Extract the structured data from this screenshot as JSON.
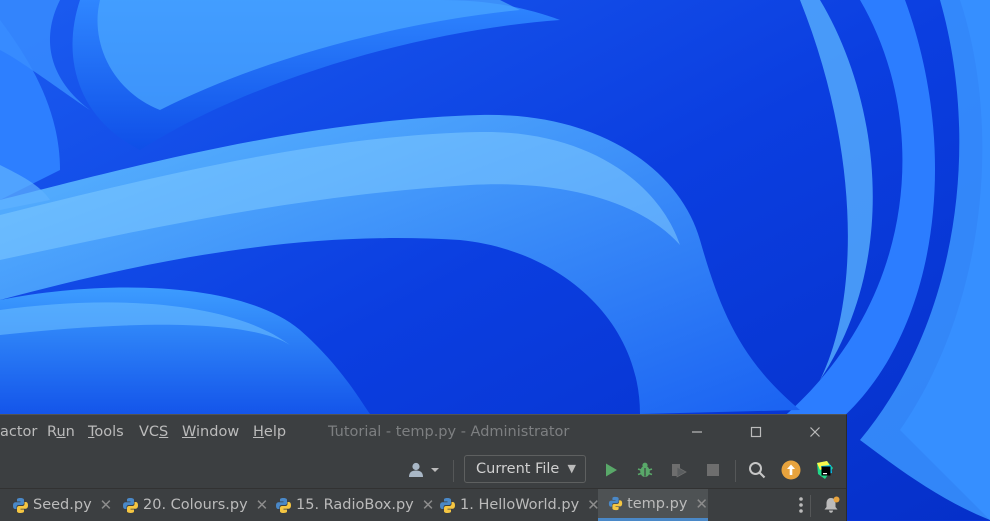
{
  "menu": {
    "items": [
      {
        "name": "refactor",
        "pre": "actor",
        "mn": "",
        "post": ""
      },
      {
        "name": "run",
        "pre": "R",
        "mn": "u",
        "post": "n"
      },
      {
        "name": "tools",
        "pre": "",
        "mn": "T",
        "post": "ools"
      },
      {
        "name": "vcs",
        "pre": "VC",
        "mn": "S",
        "post": ""
      },
      {
        "name": "window",
        "pre": "",
        "mn": "W",
        "post": "indow"
      },
      {
        "name": "help",
        "pre": "",
        "mn": "H",
        "post": "elp"
      }
    ]
  },
  "window": {
    "title": "Tutorial - temp.py - Administrator",
    "controls": {
      "minimize": "—",
      "maximize": "☐",
      "close": "✕"
    }
  },
  "toolbar": {
    "run_config_label": "Current File",
    "caret": "▼"
  },
  "tabs": [
    {
      "label": "Seed.py",
      "close": "✕",
      "active": false
    },
    {
      "label": "20. Colours.py",
      "close": "✕",
      "active": false
    },
    {
      "label": "15. RadioBox.py",
      "close": "✕",
      "active": false
    },
    {
      "label": "1. HelloWorld.py",
      "close": "✕",
      "active": false
    },
    {
      "label": "temp.py",
      "close": "✕",
      "active": true
    }
  ],
  "colors": {
    "wallpaper_base": "#0a35d8",
    "petal_light": "#3ea2ff",
    "ide_background": "#3c3f41",
    "run_green": "#59a869",
    "update_orange": "#e8a33d",
    "active_tab_underline": "#4a88c7"
  },
  "icons": [
    "account-icon",
    "run-icon",
    "debug-icon",
    "coverage-icon",
    "stop-icon",
    "search-icon",
    "update-icon",
    "ide-logo-icon",
    "more-icon",
    "notifications-icon",
    "python-file-icon"
  ]
}
